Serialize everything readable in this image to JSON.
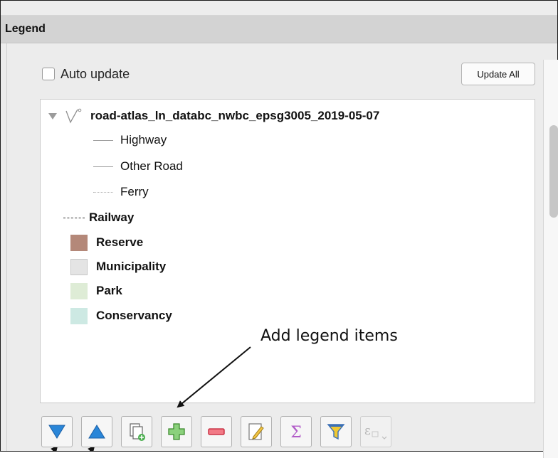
{
  "panel": {
    "title": "Legend"
  },
  "auto_update": {
    "label": "Auto update",
    "checked": false
  },
  "update_all": {
    "label": "Update All"
  },
  "tree": {
    "layer_group": {
      "name": "road-atlas_ln_databc_nwbc_epsg3005_2019-05-07",
      "expanded": true,
      "children": [
        {
          "label": "Highway",
          "symbol": "solid-line"
        },
        {
          "label": "Other Road",
          "symbol": "solid-line"
        },
        {
          "label": "Ferry",
          "symbol": "dotted-line"
        }
      ]
    },
    "items": [
      {
        "label": "Railway",
        "symbol": "dashed-line",
        "color": "#333333"
      },
      {
        "label": "Reserve",
        "symbol": "fill",
        "color": "#b48879"
      },
      {
        "label": "Municipality",
        "symbol": "fill",
        "color": "#e4e4e4"
      },
      {
        "label": "Park",
        "symbol": "fill",
        "color": "#deecd6"
      },
      {
        "label": "Conservancy",
        "symbol": "fill",
        "color": "#cde9e3"
      }
    ]
  },
  "annotation": {
    "text": "Add legend items"
  },
  "toolbar": {
    "buttons": [
      {
        "icon": "move-down-icon",
        "enabled": true
      },
      {
        "icon": "move-up-icon",
        "enabled": true
      },
      {
        "icon": "add-group-icon",
        "enabled": true
      },
      {
        "icon": "add-item-icon",
        "enabled": true
      },
      {
        "icon": "remove-item-icon",
        "enabled": true
      },
      {
        "icon": "edit-item-icon",
        "enabled": true
      },
      {
        "icon": "sum-icon",
        "enabled": true
      },
      {
        "icon": "filter-icon",
        "enabled": true
      },
      {
        "icon": "expression-icon",
        "enabled": false
      }
    ]
  },
  "colors": {
    "header_bg": "#d3d3d3",
    "panel_bg": "#ececec",
    "accent_blue": "#2a86d8",
    "accent_green": "#4caf50",
    "accent_red": "#e0334a"
  }
}
